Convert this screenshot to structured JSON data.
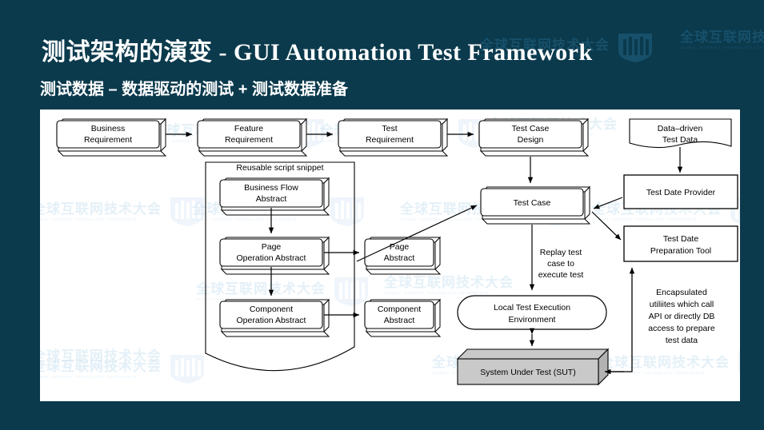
{
  "slide": {
    "title": "测试架构的演变 -  GUI Automation Test Framework",
    "subtitle": "测试数据 – 数据驱动的测试 + 测试数据准备",
    "background_color": "#0b3a4d",
    "panel_color": "#ffffff"
  },
  "watermark": {
    "cn": "全球互联网技术大会",
    "en": "GLOBAL INTERNET TECHNOLOGY CONFERENCE",
    "logo": "gitc-shield-logo"
  },
  "diagram": {
    "title": "GUI Automation Test Framework — test data flow",
    "group_label": "Reusable script snippet",
    "boxes": {
      "business_requirement": "Business\nRequirement",
      "business_requirement_l1": "Business",
      "business_requirement_l2": "Requirement",
      "feature_requirement_l1": "Feature",
      "feature_requirement_l2": "Requirement",
      "test_requirement_l1": "Test",
      "test_requirement_l2": "Requirement",
      "test_case_design_l1": "Test Case",
      "test_case_design_l2": "Design",
      "data_driven_test_data_l1": "Data–driven",
      "data_driven_test_data_l2": "Test Data",
      "test_date_provider": "Test Date Provider",
      "test_date_preparation_tool_l1": "Test Date",
      "test_date_preparation_tool_l2": "Preparation Tool",
      "business_flow_abstract_l1": "Business Flow",
      "business_flow_abstract_l2": "Abstract",
      "page_operation_abstract_l1": "Page",
      "page_operation_abstract_l2": "Operation Abstract",
      "page_abstract_l1": "Page",
      "page_abstract_l2": "Abstract",
      "component_operation_abstract_l1": "Component",
      "component_operation_abstract_l2": "Operation Abstract",
      "component_abstract_l1": "Component",
      "component_abstract_l2": "Abstract",
      "test_case": "Test Case",
      "local_test_execution_environment_l1": "Local Test Execution",
      "local_test_execution_environment_l2": "Environment",
      "system_under_test": "System Under Test (SUT)"
    },
    "annotations": {
      "replay_l1": "Replay test",
      "replay_l2": "case to",
      "replay_l3": "execute test",
      "encapsulated_l1": "Encapsulated",
      "encapsulated_l2": "utiliites which call",
      "encapsulated_l3": "API or directly DB",
      "encapsulated_l4": "access to prepare",
      "encapsulated_l5": "test data"
    },
    "colors": {
      "stroke": "#000000",
      "box_fill": "#ffffff",
      "sut_fill": "#c9c9c9",
      "sut_side_fill": "#b0b0b0"
    }
  }
}
